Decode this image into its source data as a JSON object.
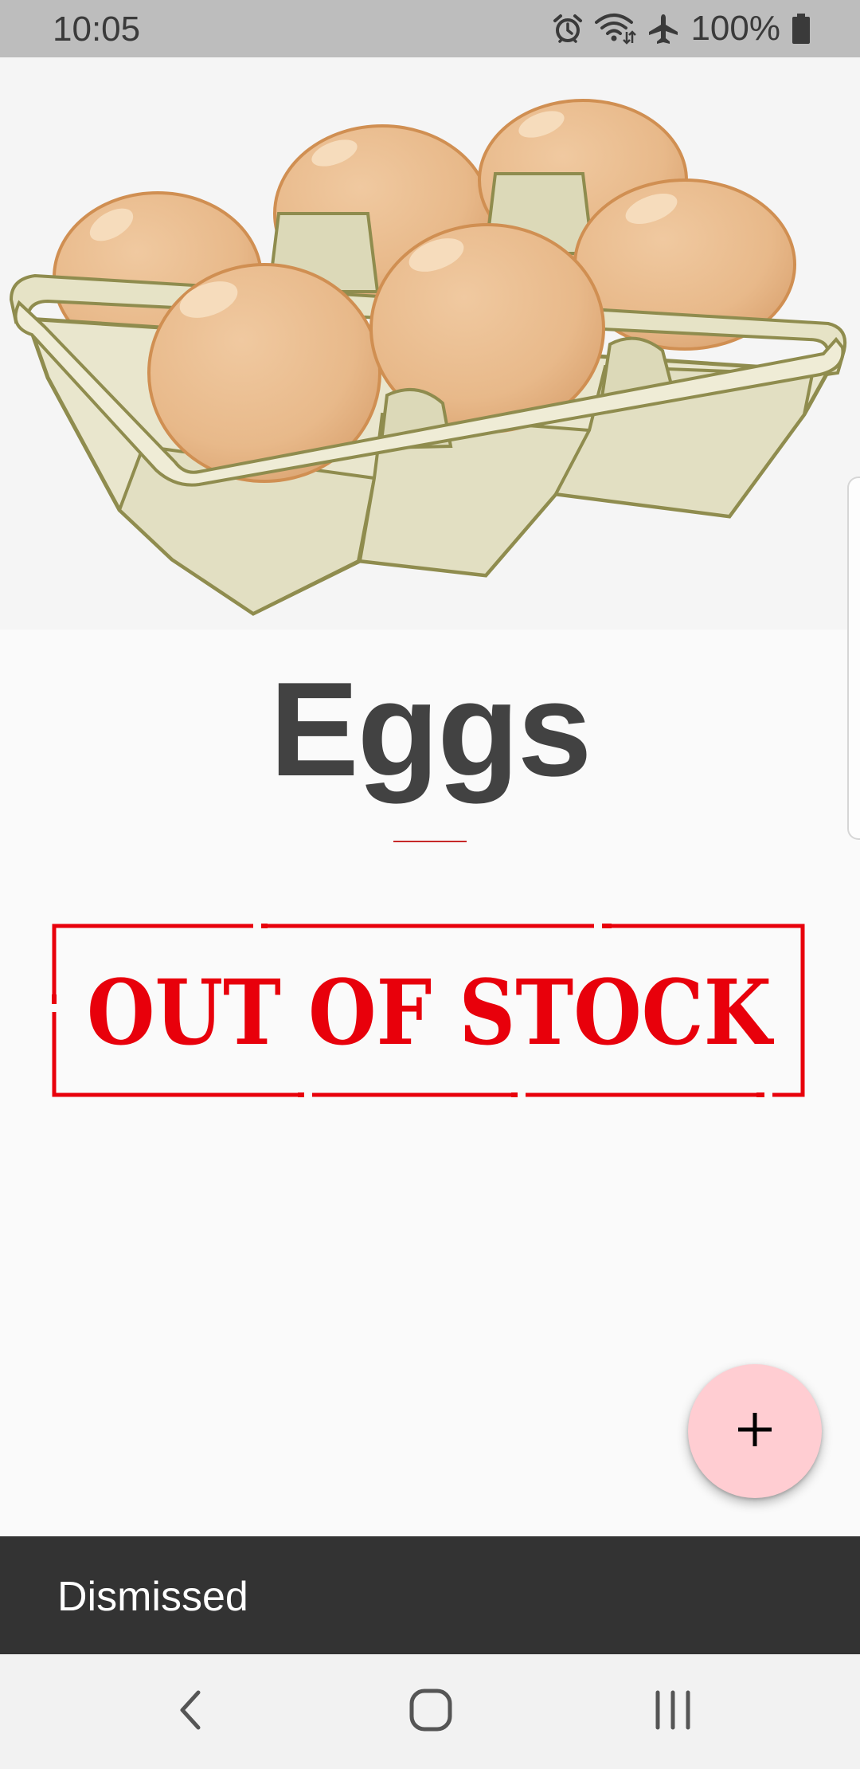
{
  "status_bar": {
    "time": "10:05",
    "battery": "100%",
    "icons": [
      "alarm-icon",
      "wifi-icon",
      "airplane-icon",
      "battery-icon"
    ]
  },
  "product": {
    "image_icon": "egg-carton",
    "name": "Eggs",
    "stock_status": "OUT OF STOCK",
    "accent_color": "#c62828",
    "stamp_color": "#e8000b"
  },
  "fab": {
    "icon": "plus-icon",
    "background": "#ffcdd2"
  },
  "snackbar": {
    "message": "Dismissed"
  },
  "nav_bar": {
    "buttons": [
      "back-icon",
      "home-icon",
      "recents-icon"
    ]
  }
}
